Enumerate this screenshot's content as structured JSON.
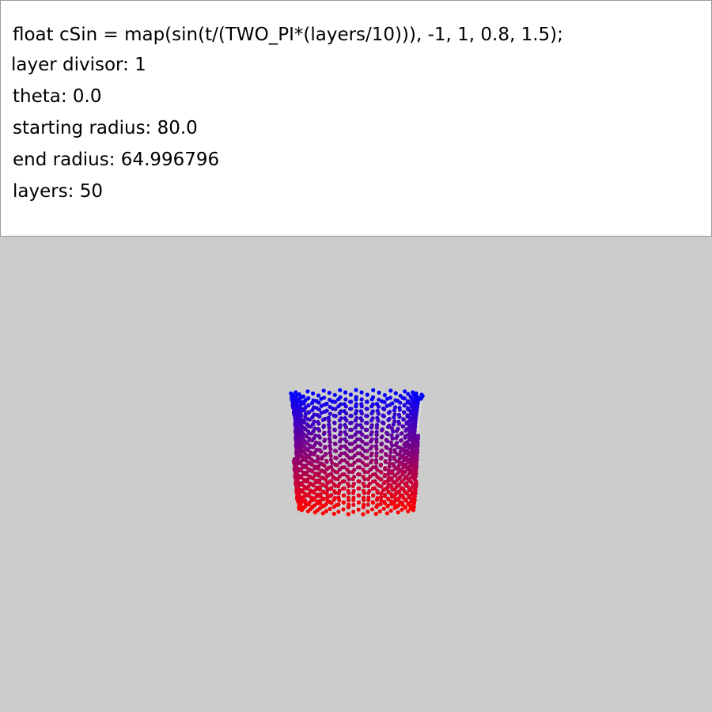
{
  "info": {
    "code_line": "float cSin = map(sin(t/(TWO_PI*(layers/10))), -1, 1, 0.8, 1.5);",
    "layer_divisor": "layer divisor: 1",
    "theta": "theta: 0.0",
    "starting_radius": "starting radius: 80.0",
    "end_radius": "end radius: 64.996796",
    "layers": "layers: 50"
  },
  "visualization": {
    "layer_count": 50,
    "points_per_layer": 24,
    "color_top": "#0000ff",
    "color_bottom": "#ff0000",
    "background": "#cccccc"
  }
}
